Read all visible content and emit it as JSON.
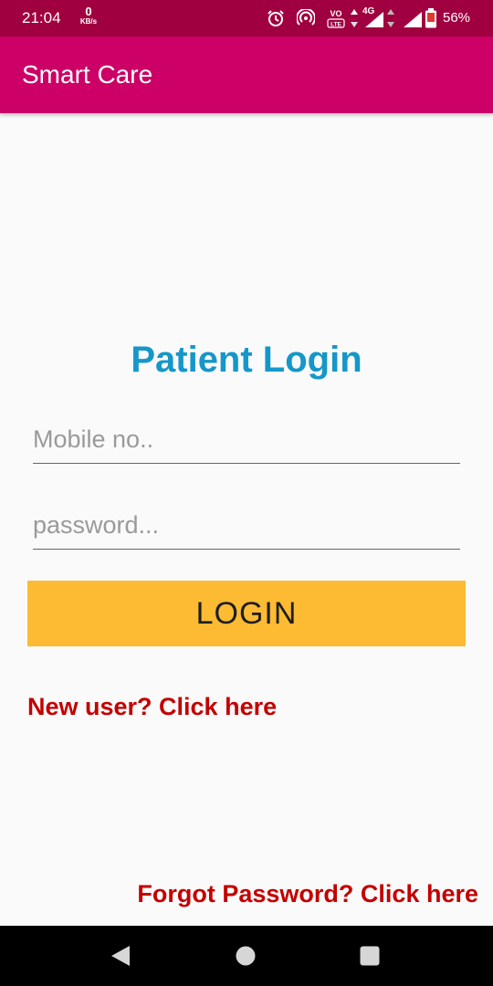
{
  "status_bar": {
    "time": "21:04",
    "net_speed_value": "0",
    "net_speed_unit": "KB/s",
    "network_type": "4G",
    "battery_percent": "56%"
  },
  "app_bar": {
    "title": "Smart Care"
  },
  "login": {
    "heading": "Patient Login",
    "mobile_placeholder": "Mobile no..",
    "mobile_value": "",
    "password_placeholder": "password...",
    "password_value": "",
    "login_button_label": "LOGIN",
    "new_user_link": "New user? Click here",
    "forgot_password_link": "Forgot Password? Click here"
  },
  "nav_bar": {
    "buttons": [
      "back-icon",
      "home-icon",
      "recents-icon"
    ]
  },
  "colors": {
    "status_bar": "#a10040",
    "app_bar": "#cc0066",
    "heading": "#1597c9",
    "button": "#fdbb33",
    "links": "#c40000"
  }
}
